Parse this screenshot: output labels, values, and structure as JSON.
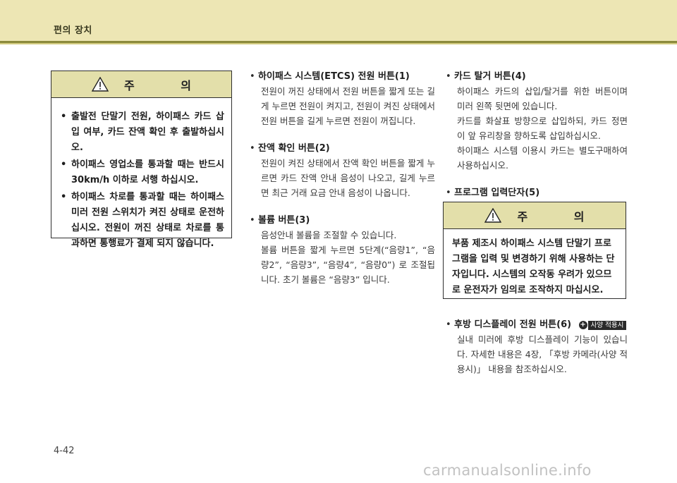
{
  "header": {
    "section_title": "편의 장치"
  },
  "page_number": "4-42",
  "watermark": "carmanualsonline.info",
  "caution_label": "주 의",
  "left_caution": {
    "items": [
      "출발전 단말기 전원, 하이패스 카드 삽입 여부, 카드 잔액 확인 후 출발하십시오.",
      "하이패스 영업소를 통과할 때는 반드시 30km/h 이하로 서행 하십시오.",
      "하이패스 차로를 통과할 때는 하이패스미러 전원 스위치가 켜진 상태로 운전하십시오. 전원이 꺼진 상태로 차로를 통과하면 통행료가 결제 되지 않습니다."
    ]
  },
  "middle": {
    "items": [
      {
        "title": "하이패스 시스템(ETCS) 전원 버튼(1)",
        "body": [
          "전원이 꺼진 상태에서 전원 버튼을 짧게 또는 길게 누르면 전원이 켜지고, 전원이 켜진 상태에서 전원 버튼을 길게 누르면 전원이 꺼집니다."
        ]
      },
      {
        "title": "잔액 확인 버튼(2)",
        "body": [
          "전원이 켜진 상태에서 잔액 확인 버튼을 짧게 누르면 카드 잔액 안내 음성이 나오고, 길게 누르면 최근 거래 요금 안내 음성이 나옵니다."
        ]
      },
      {
        "title": "볼륨 버튼(3)",
        "body": [
          "음성안내 볼륨을 조절할 수 있습니다.",
          "볼륨 버튼을 짧게 누르면 5단계(“음량1”, “음량2”, “음량3”, “음량4”, “음량0”) 로 조절됩니다. 초기 볼륨은 “음량3” 입니다."
        ]
      }
    ]
  },
  "right": {
    "card_item": {
      "title": "카드 탈거 버튼(4)",
      "body": [
        "하이패스 카드의 삽입/탈거를 위한 버튼이며 미러 왼쪽 뒷면에 있습니다.",
        "카드를 화살표 방향으로 삽입하되, 카드 정면이 앞 유리창을 향하도록 삽입하십시오.",
        "하이패스 시스템 이용시 카드는 별도구매하여 사용하십시오."
      ]
    },
    "program_item": {
      "title": "프로그램 입력단자(5)"
    },
    "caution_text": "부품 제조시 하이패스 시스템 단말기 프로그램을 입력 및 변경하기 위해 사용하는 단자입니다. 시스템의 오작동 우려가 있으므로 운전자가 임의로 조작하지 마십시오.",
    "rear_item": {
      "title": "후방 디스플레이 전원 버튼(6)",
      "badge": "사양 적용시",
      "body": [
        "실내 미러에 후방 디스플레이 기능이 있습니다. 자세한 내용은 4장, 「후방 카메라(사양 적용시)」 내용을 참조하십시오."
      ]
    }
  }
}
